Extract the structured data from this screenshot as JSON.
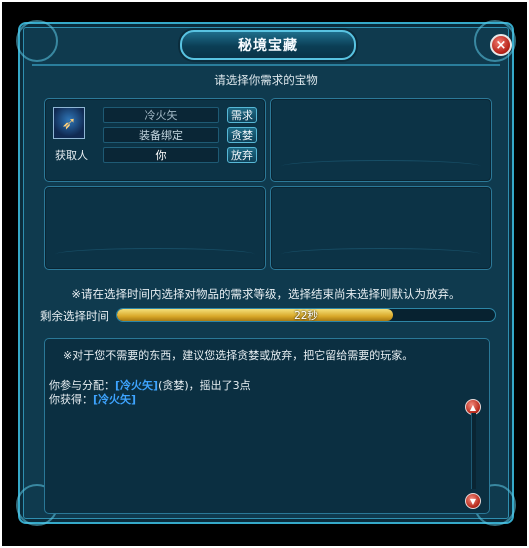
{
  "window": {
    "title": "秘境宝藏",
    "close_symbol": "×"
  },
  "prompt": "请选择你需求的宝物",
  "item": {
    "name": "冷火矢",
    "binding": "装备绑定",
    "winner_label": "获取人",
    "winner_value": "你",
    "icon": "golden-arrow-icon"
  },
  "buttons": {
    "need": "需求",
    "greed": "贪婪",
    "pass": "放弃"
  },
  "rules_note": "※请在选择时间内选择对物品的需求等级，选择结束尚未选择则默认为放弃。",
  "timer": {
    "label": "剩余选择时间",
    "text": "22秒",
    "remaining_fraction": 0.73
  },
  "log": {
    "hint": "※对于您不需要的东西，建议您选择贪婪或放弃，把它留给需要的玩家。",
    "line1": {
      "prefix": "你参与分配：",
      "item": "[冷火矢]",
      "suffix": "(贪婪)，摇出了3点"
    },
    "line2": {
      "prefix": "你获得：",
      "item": "[冷火矢]"
    }
  },
  "colors": {
    "frame": "#35a9c9",
    "panel": "#0f3a4e",
    "item_link": "#3ea4ff",
    "timer_fill": "#d9a92a",
    "close": "#b8241a"
  }
}
